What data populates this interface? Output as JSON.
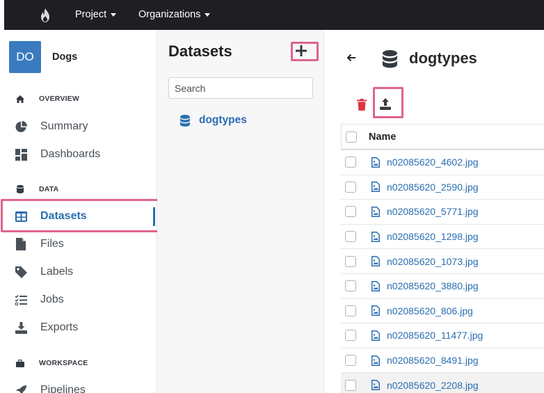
{
  "topbar": {
    "logo_icon": "flame-logo-icon",
    "menus": [
      {
        "label": "Project"
      },
      {
        "label": "Organizations"
      }
    ]
  },
  "sidebar": {
    "avatar_text": "DO",
    "project_name": "Dogs",
    "sections": {
      "overview": "OVERVIEW",
      "data": "DATA",
      "workspace": "WORKSPACE"
    },
    "items": {
      "summary": "Summary",
      "dashboards": "Dashboards",
      "datasets": "Datasets",
      "files": "Files",
      "labels": "Labels",
      "jobs": "Jobs",
      "exports": "Exports",
      "pipelines": "Pipelines"
    },
    "active_item": "Datasets"
  },
  "datasets_panel": {
    "title": "Datasets",
    "search_placeholder": "Search",
    "items": [
      "dogtypes"
    ]
  },
  "main": {
    "dataset_name": "dogtypes",
    "table": {
      "header": "Name",
      "files": [
        "n02085620_4602.jpg",
        "n02085620_2590.jpg",
        "n02085620_5771.jpg",
        "n02085620_1298.jpg",
        "n02085620_1073.jpg",
        "n02085620_3880.jpg",
        "n02085620_806.jpg",
        "n02085620_11477.jpg",
        "n02085620_8491.jpg",
        "n02085620_2208.jpg"
      ]
    }
  },
  "colors": {
    "accent": "#2a6eb0",
    "highlight": "#e0648a",
    "navbar": "#1e1e23",
    "delete": "#dc3545"
  }
}
